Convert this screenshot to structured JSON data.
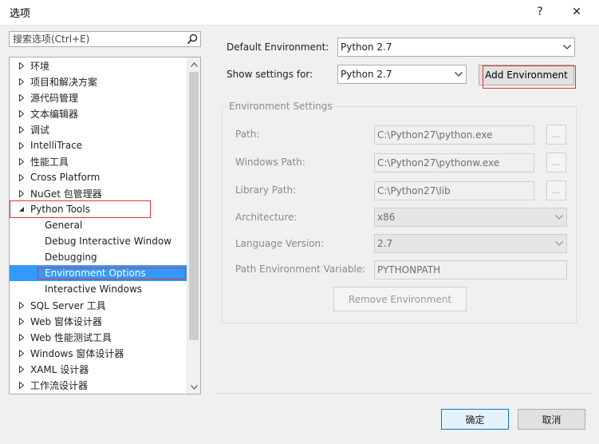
{
  "window": {
    "title": "选项",
    "help_button": "?",
    "close_button": "✕"
  },
  "search": {
    "placeholder": "搜索选项(Ctrl+E)"
  },
  "tree": {
    "items": [
      {
        "label": "环境",
        "expanded": false
      },
      {
        "label": "项目和解决方案",
        "expanded": false
      },
      {
        "label": "源代码管理",
        "expanded": false
      },
      {
        "label": "文本编辑器",
        "expanded": false
      },
      {
        "label": "调试",
        "expanded": false
      },
      {
        "label": "IntelliTrace",
        "expanded": false
      },
      {
        "label": "性能工具",
        "expanded": false
      },
      {
        "label": "Cross Platform",
        "expanded": false
      },
      {
        "label": "NuGet 包管理器",
        "expanded": false
      },
      {
        "label": "Python Tools",
        "expanded": true
      },
      {
        "label": "General",
        "child": true
      },
      {
        "label": "Debug Interactive Window",
        "child": true
      },
      {
        "label": "Debugging",
        "child": true
      },
      {
        "label": "Environment Options",
        "child": true,
        "selected": true
      },
      {
        "label": "Interactive Windows",
        "child": true
      },
      {
        "label": "SQL Server 工具",
        "expanded": false
      },
      {
        "label": "Web 窗体设计器",
        "expanded": false
      },
      {
        "label": "Web 性能测试工具",
        "expanded": false
      },
      {
        "label": "Windows 窗体设计器",
        "expanded": false
      },
      {
        "label": "XAML 设计器",
        "expanded": false
      },
      {
        "label": "工作流设计器",
        "expanded": false
      }
    ]
  },
  "settings": {
    "default_env_label": "Default Environment:",
    "default_env_value": "Python 2.7",
    "show_settings_label": "Show settings for:",
    "show_settings_value": "Python 2.7",
    "add_env_button": "Add Environment",
    "group_title": "Environment Settings",
    "path_label": "Path:",
    "path_value": "C:\\Python27\\python.exe",
    "win_path_label": "Windows Path:",
    "win_path_value": "C:\\Python27\\pythonw.exe",
    "lib_path_label": "Library Path:",
    "lib_path_value": "C:\\Python27\\lib",
    "browse_label": "...",
    "arch_label": "Architecture:",
    "arch_value": "x86",
    "lang_label": "Language Version:",
    "lang_value": "2.7",
    "path_env_label": "Path Environment Variable:",
    "path_env_value": "PYTHONPATH",
    "remove_button": "Remove Environment"
  },
  "footer": {
    "ok_button": "确定",
    "cancel_button": "取消"
  },
  "colors": {
    "selection": "#3399ff",
    "highlight_box": "#e53333"
  }
}
